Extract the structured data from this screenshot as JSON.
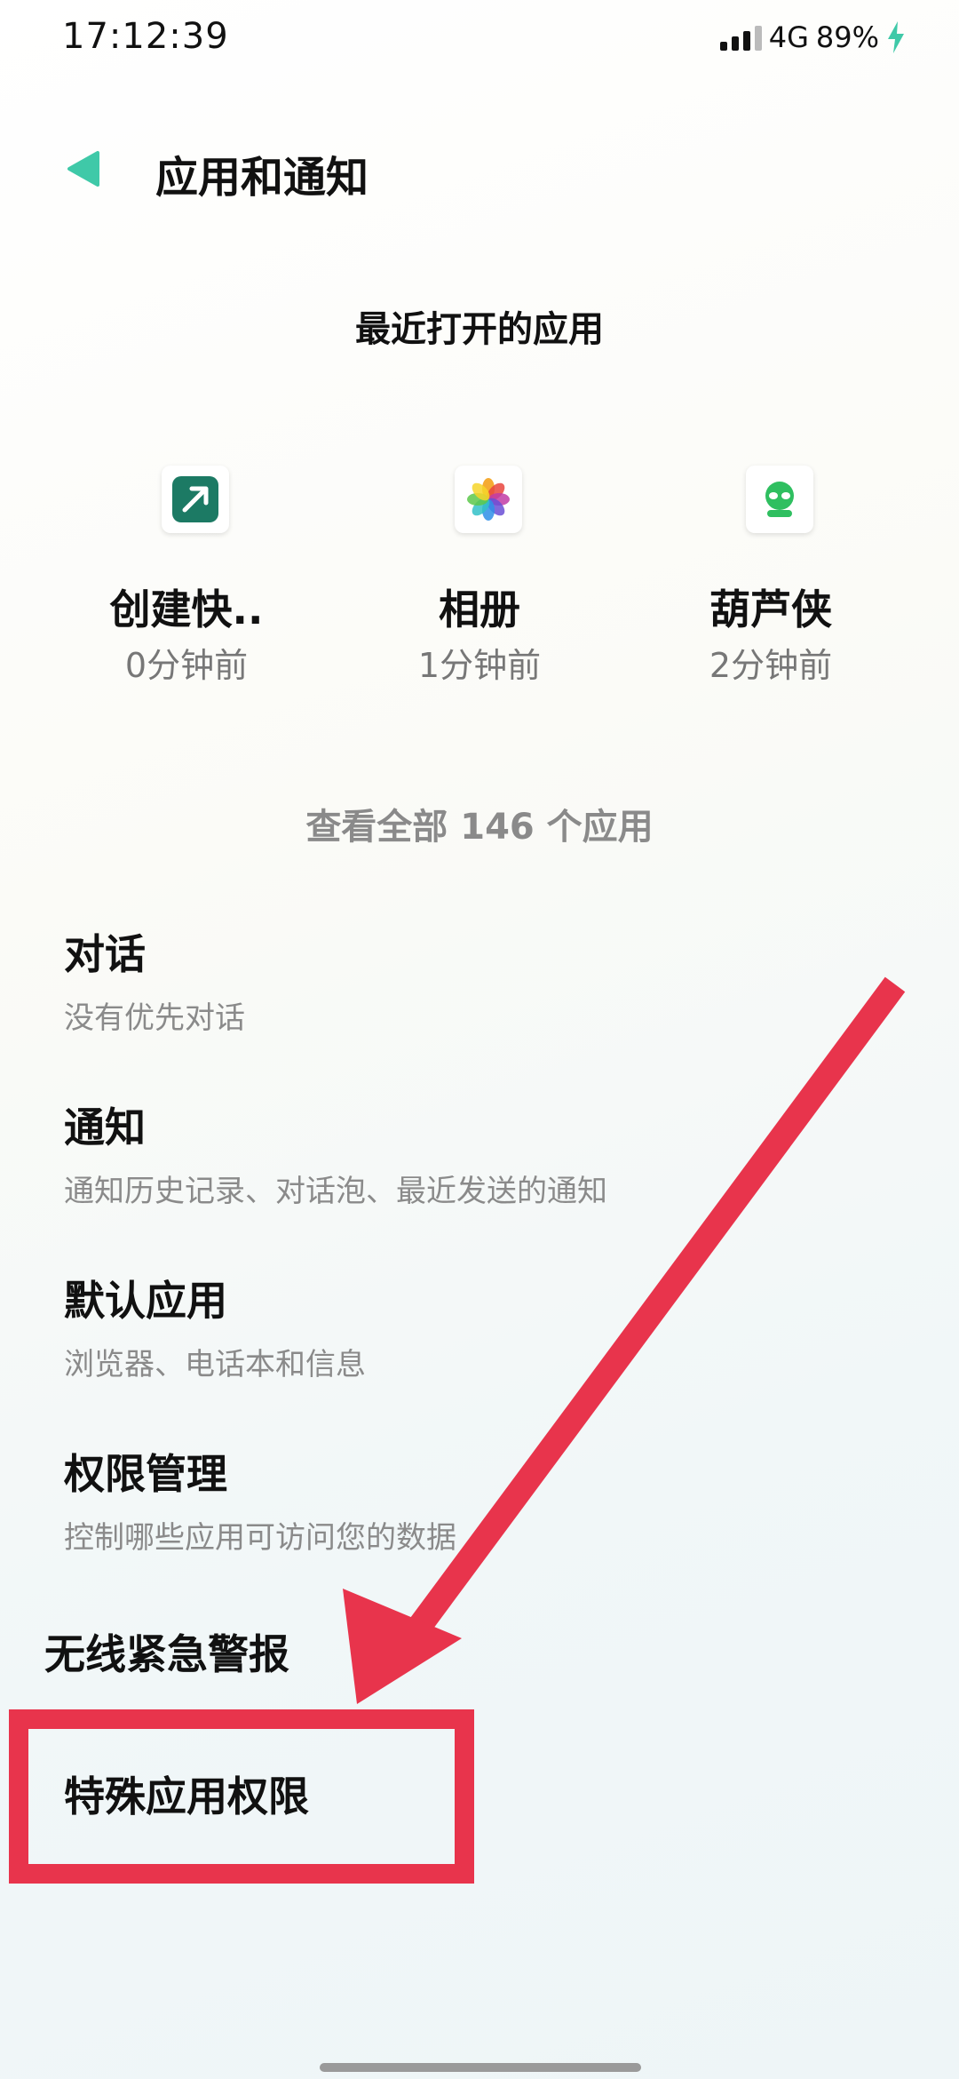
{
  "status_bar": {
    "time": "17:12:39",
    "network": "4G",
    "battery": "89%"
  },
  "header": {
    "title": "应用和通知",
    "back_icon": "back-arrow-icon"
  },
  "recent": {
    "title": "最近打开的应用",
    "apps": [
      {
        "name": "创建快..",
        "time": "0分钟前",
        "icon": "share-arrow-icon",
        "color": "#1c7a64"
      },
      {
        "name": "相册",
        "time": "1分钟前",
        "icon": "photos-flower-icon",
        "color": "#f4a21d"
      },
      {
        "name": "葫芦侠",
        "time": "2分钟前",
        "icon": "alien-face-icon",
        "color": "#2fbf60"
      }
    ],
    "view_all": "查看全部 146 个应用"
  },
  "settings": [
    {
      "title": "对话",
      "subtitle": "没有优先对话"
    },
    {
      "title": "通知",
      "subtitle": "通知历史记录、对话泡、最近发送的通知"
    },
    {
      "title": "默认应用",
      "subtitle": "浏览器、电话本和信息"
    },
    {
      "title": "权限管理",
      "subtitle": "控制哪些应用可访问您的数据"
    },
    {
      "title": "无线紧急警报"
    },
    {
      "title": "特殊应用权限"
    }
  ],
  "colors": {
    "accent": "#3fc9a8",
    "annotation": "#e8344c",
    "battery_bolt": "#3fc9a8"
  }
}
